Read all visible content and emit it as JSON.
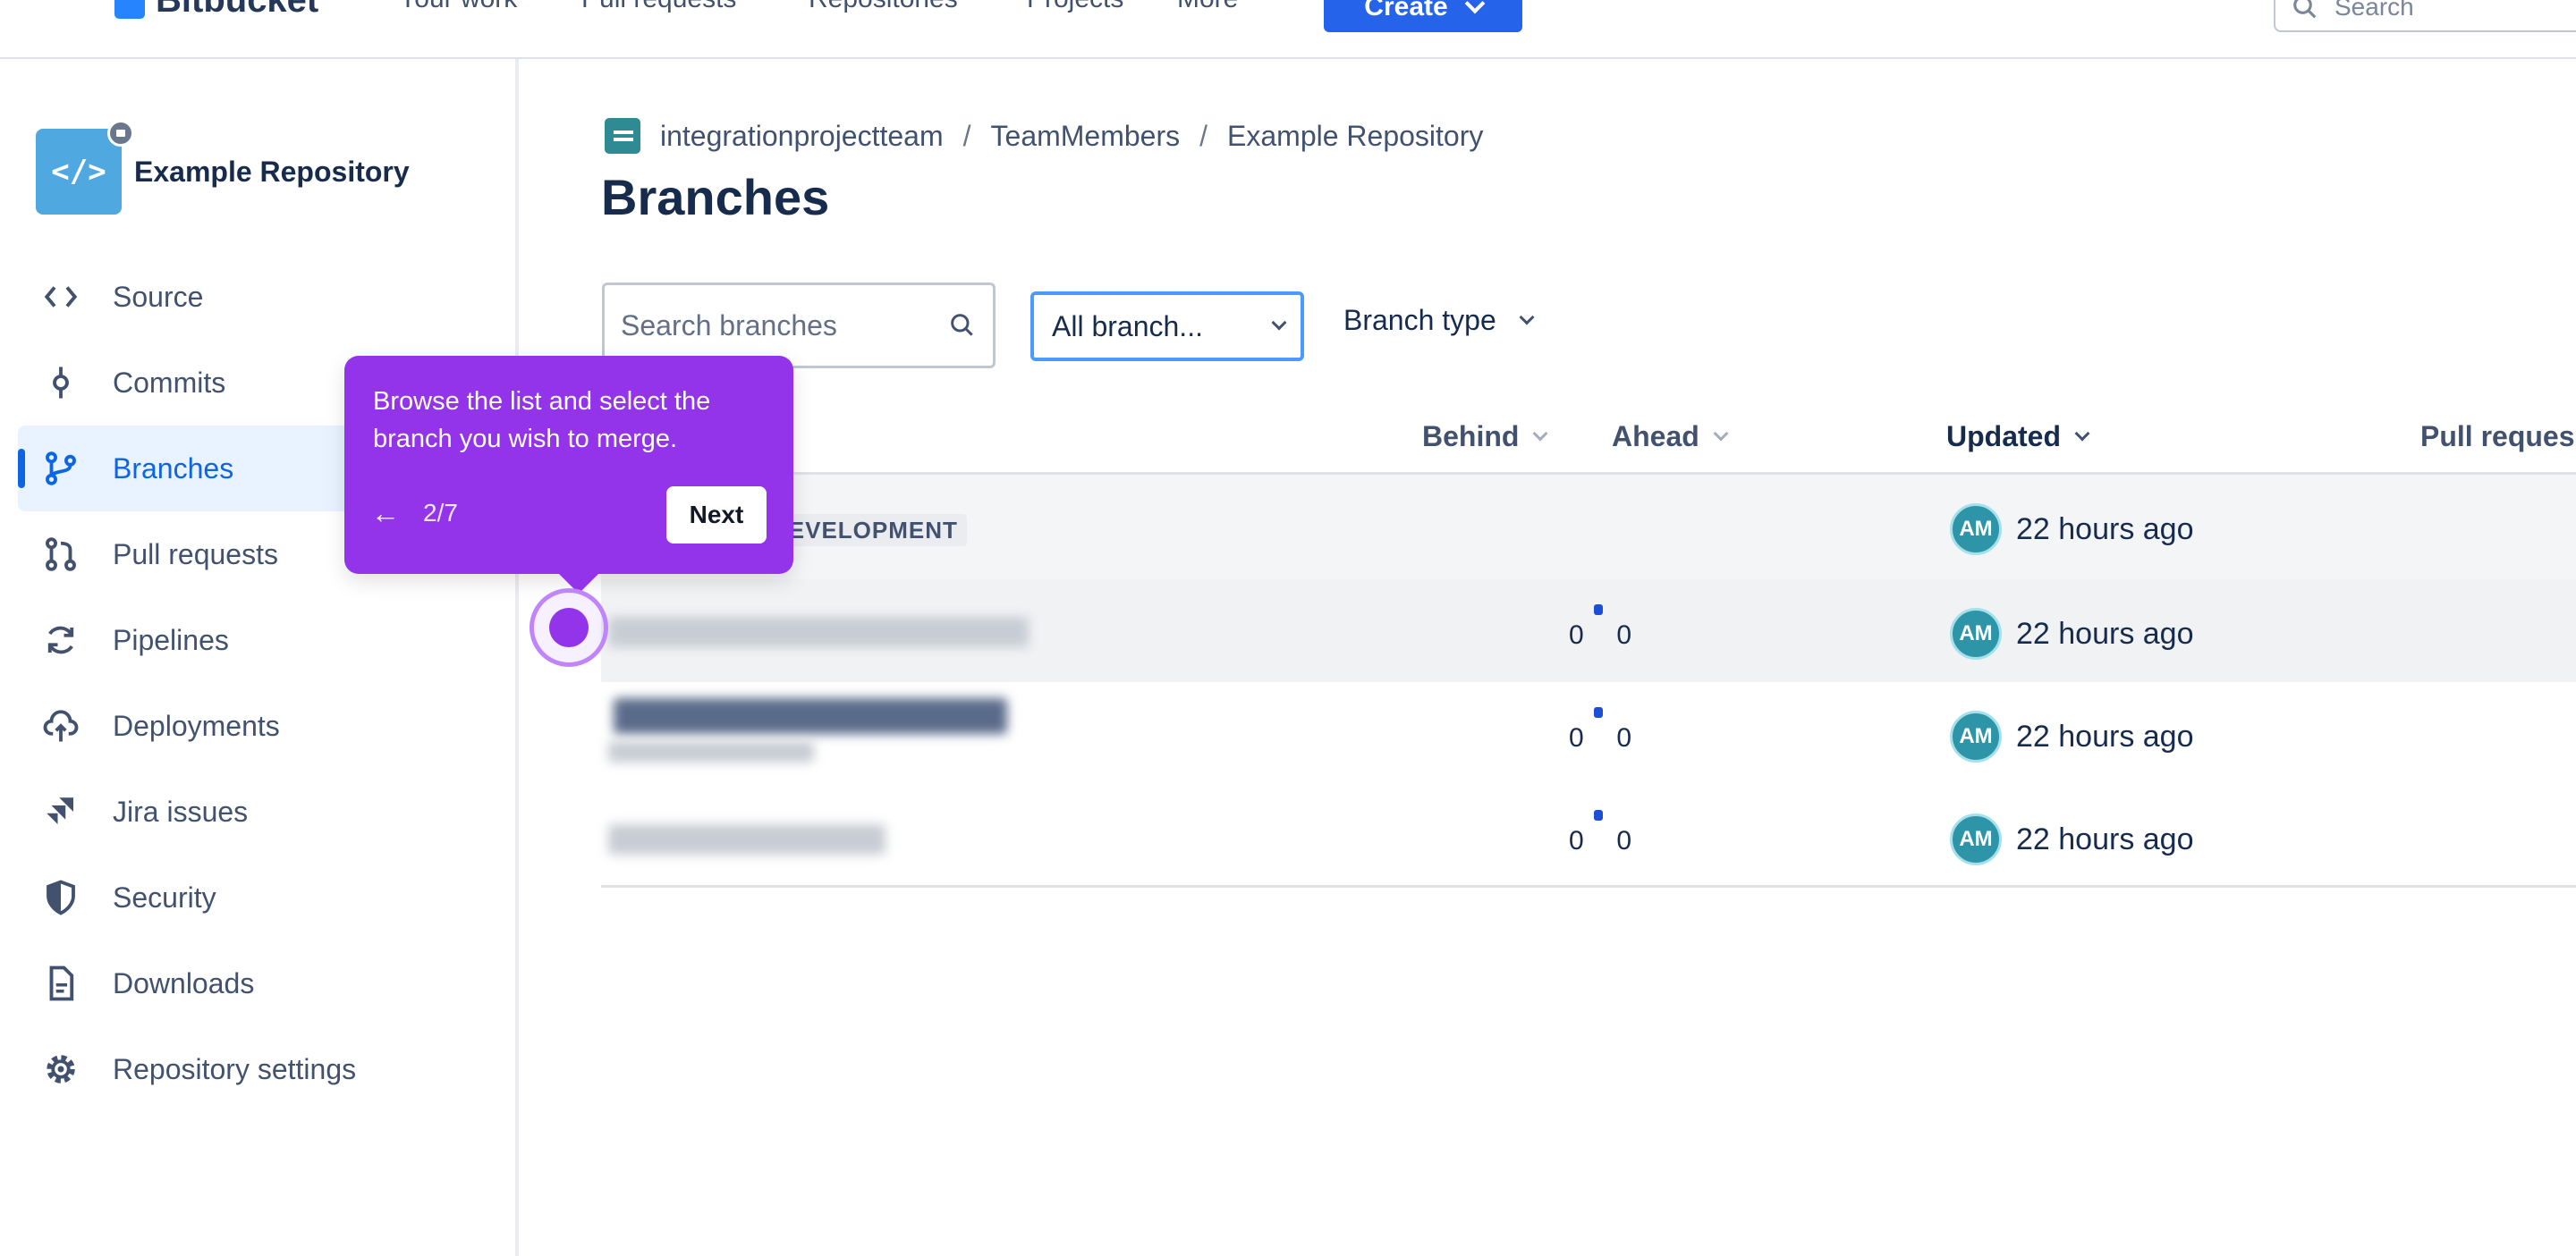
{
  "topnav": {
    "brand": "Bitbucket",
    "items": [
      "Your work",
      "Pull requests",
      "Repositories",
      "Projects",
      "More"
    ],
    "create_label": "Create",
    "search_placeholder": "Search"
  },
  "repo": {
    "name": "Example Repository",
    "avatar_glyph": "</>"
  },
  "sidebar": {
    "items": [
      {
        "label": "Source",
        "icon": "code-icon"
      },
      {
        "label": "Commits",
        "icon": "commit-icon"
      },
      {
        "label": "Branches",
        "icon": "branch-icon",
        "active": true
      },
      {
        "label": "Pull requests",
        "icon": "pull-request-icon"
      },
      {
        "label": "Pipelines",
        "icon": "pipelines-icon"
      },
      {
        "label": "Deployments",
        "icon": "cloud-upload-icon"
      },
      {
        "label": "Jira issues",
        "icon": "jira-icon"
      },
      {
        "label": "Security",
        "icon": "shield-icon"
      },
      {
        "label": "Downloads",
        "icon": "document-icon"
      },
      {
        "label": "Repository settings",
        "icon": "gear-icon"
      }
    ]
  },
  "breadcrumb": {
    "workspace": "integrationprojectteam",
    "project": "TeamMembers",
    "repo": "Example Repository",
    "separator": "/"
  },
  "page": {
    "title": "Branches"
  },
  "filters": {
    "search_placeholder": "Search branches",
    "all_branches": "All branch...",
    "branch_type": "Branch type"
  },
  "table": {
    "columns": {
      "behind": "Behind",
      "ahead": "Ahead",
      "updated": "Updated",
      "pull_requests": "Pull reques"
    },
    "rows": [
      {
        "badge": "DEVELOPMENT",
        "behind": "",
        "ahead": "",
        "avatar": "AM",
        "updated": "22 hours ago"
      },
      {
        "behind": "0",
        "ahead": "0",
        "avatar": "AM",
        "updated": "22 hours ago"
      },
      {
        "behind": "0",
        "ahead": "0",
        "avatar": "AM",
        "updated": "22 hours ago"
      },
      {
        "behind": "0",
        "ahead": "0",
        "avatar": "AM",
        "updated": "22 hours ago"
      }
    ]
  },
  "tooltip": {
    "text": "Browse the list and select the branch you wish to merge.",
    "back": "←",
    "step": "2/7",
    "next_label": "Next"
  },
  "colors": {
    "accent": "#9333ea",
    "primary": "#2563eb",
    "active_nav": "#0c66e4"
  }
}
